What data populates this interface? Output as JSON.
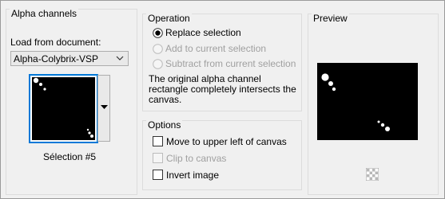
{
  "alpha_channels": {
    "title": "Alpha channels",
    "load_label": "Load from document:",
    "document_value": "Alpha-Colybrix-VSP",
    "selection_name": "Sélection #5"
  },
  "operation": {
    "title": "Operation",
    "options": [
      {
        "label": "Replace selection",
        "selected": true,
        "enabled": true
      },
      {
        "label": "Add to current selection",
        "selected": false,
        "enabled": false
      },
      {
        "label": "Subtract from current selection",
        "selected": false,
        "enabled": false
      }
    ],
    "info": "The original alpha channel rectangle completely intersects the canvas.",
    "info_line1": "The original alpha channel",
    "info_line2": "rectangle completely intersects the",
    "info_line3": "canvas."
  },
  "options": {
    "title": "Options",
    "items": [
      {
        "label": "Move to upper left of canvas",
        "checked": false,
        "enabled": true
      },
      {
        "label": "Clip to canvas",
        "checked": false,
        "enabled": false
      },
      {
        "label": "Invert image",
        "checked": false,
        "enabled": true
      }
    ]
  },
  "preview": {
    "title": "Preview"
  },
  "icons": {
    "dropdown": "chevron-down-icon",
    "thumb_menu": "triangle-down-icon",
    "transparency": "checkerboard-icon"
  },
  "colors": {
    "accent": "#0078d7",
    "background": "#f0f0f0",
    "disabled_text": "#a0a0a0"
  }
}
